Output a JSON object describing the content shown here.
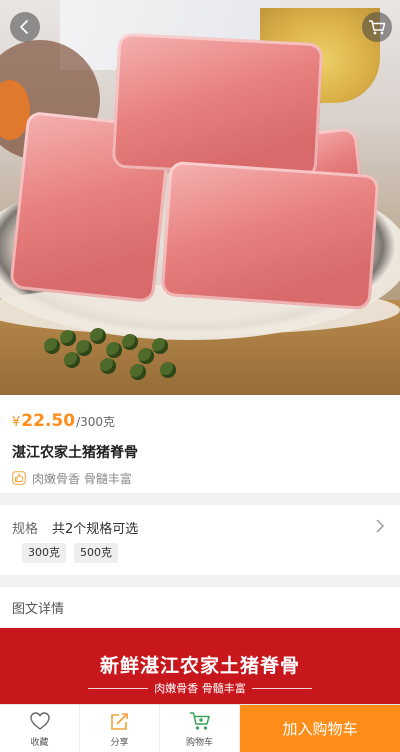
{
  "product": {
    "currency": "¥",
    "price": "22.50",
    "unit": "/300克",
    "name": "湛江农家土猪猪脊骨",
    "tagline": "肉嫩骨香 骨髓丰富"
  },
  "spec": {
    "label": "规格",
    "summary": "共2个规格可选",
    "options": [
      "300克",
      "500克"
    ]
  },
  "detail": {
    "label": "图文详情"
  },
  "banner": {
    "title": "新鲜湛江农家土猪脊骨",
    "subtitle": "肉嫩骨香 骨髓丰富"
  },
  "bottom_bar": {
    "favorite": "收藏",
    "share": "分享",
    "cart": "购物车",
    "add_to_cart": "加入购物车"
  },
  "colors": {
    "accent": "#ff8d1a",
    "banner": "#c8161d"
  }
}
